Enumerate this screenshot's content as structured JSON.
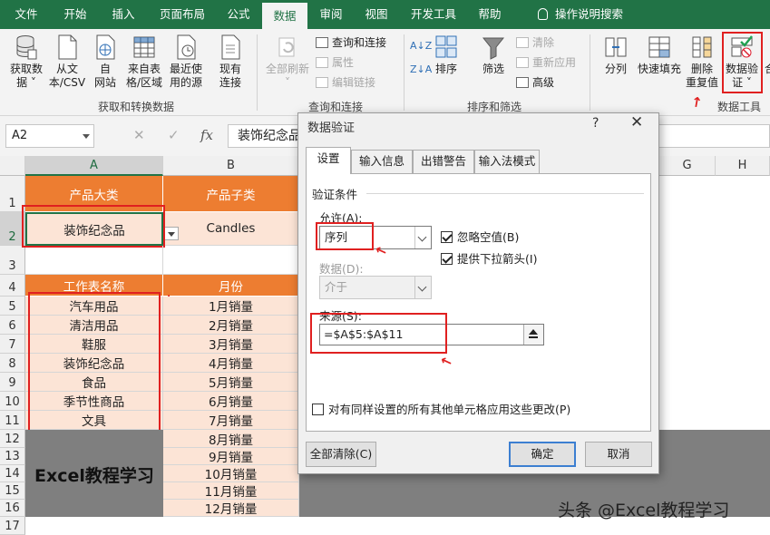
{
  "menu": {
    "tabs": [
      "文件",
      "开始",
      "插入",
      "页面布局",
      "公式",
      "数据",
      "审阅",
      "视图",
      "开发工具",
      "帮助"
    ],
    "active": "数据",
    "tell_me": "操作说明搜索"
  },
  "ribbon": {
    "get_data": {
      "l1": "获取数",
      "l2": "据"
    },
    "from_text": {
      "l1": "从文",
      "l2": "本/CSV"
    },
    "from_web": {
      "l1": "自",
      "l2": "网站"
    },
    "from_table": {
      "l1": "来自表",
      "l2": "格/区域"
    },
    "recent_sources": {
      "l1": "最近使",
      "l2": "用的源"
    },
    "existing": {
      "l1": "现有",
      "l2": "连接"
    },
    "group_get": "获取和转换数据",
    "refresh_all": "全部刷新",
    "queries_connections": "查询和连接",
    "properties": "属性",
    "edit_links": "编辑链接",
    "group_query": "查询和连接",
    "sort_az": "A↓Z",
    "sort_za": "Z↓A",
    "sort": "排序",
    "filter": "筛选",
    "clear": "清除",
    "reapply": "重新应用",
    "advanced": "高级",
    "group_sort": "排序和筛选",
    "text_to_columns": "分列",
    "flash_fill": "快速填充",
    "remove_dup": {
      "l1": "删除",
      "l2": "重复值"
    },
    "data_validation": {
      "l1": "数据验",
      "l2": "证"
    },
    "consolidate": "合",
    "group_tools": "数据工具"
  },
  "formula_bar": {
    "name_box": "A2",
    "content": "装饰纪念品",
    "fx": "fx"
  },
  "columns": [
    "A",
    "B",
    "G",
    "H"
  ],
  "rows": [
    "1",
    "2",
    "3",
    "4",
    "5",
    "6",
    "7",
    "8",
    "9",
    "10",
    "11",
    "12",
    "13",
    "14",
    "15",
    "16",
    "17"
  ],
  "sheet": {
    "a1": "产品大类",
    "b1": "产品子类",
    "a2": "装饰纪念品",
    "b2": "Candles",
    "a4": "工作表名称",
    "b4": "月份",
    "sheet_names": [
      "汽车用品",
      "清洁用品",
      "鞋服",
      "装饰纪念品",
      "食品",
      "季节性商品",
      "文具"
    ],
    "months": [
      "1月销量",
      "2月销量",
      "3月销量",
      "4月销量",
      "5月销量",
      "6月销量",
      "7月销量",
      "8月销量",
      "9月销量",
      "10月销量",
      "11月销量",
      "12月销量"
    ],
    "block_text": "Excel教程学习"
  },
  "dialog": {
    "title": "数据验证",
    "help": "?",
    "close": "✕",
    "tabs": [
      "设置",
      "输入信息",
      "出错警告",
      "输入法模式"
    ],
    "section": "验证条件",
    "allow_label": "允许(A):",
    "allow_value": "序列",
    "ignore_blank": "忽略空值(B)",
    "dropdown": "提供下拉箭头(I)",
    "data_label": "数据(D):",
    "data_value": "介于",
    "source_label": "来源(S):",
    "source_value": "=$A$5:$A$11",
    "apply_all": "对有同样设置的所有其他单元格应用这些更改(P)",
    "clear_all": "全部清除(C)",
    "ok": "确定",
    "cancel": "取消"
  },
  "watermark": "头条 @Excel教程学习",
  "colors": {
    "excel_green": "#217346",
    "orange": "#ed7d31",
    "peach": "#fce4d6",
    "red": "#e02020"
  }
}
